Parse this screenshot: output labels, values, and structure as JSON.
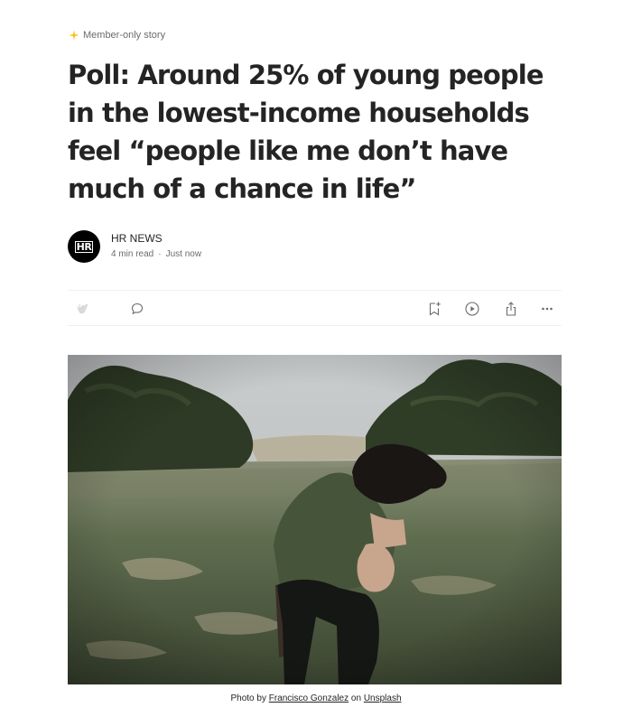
{
  "badge": {
    "label": "Member-only story",
    "icon": "star-icon",
    "color": "#ffc017"
  },
  "article": {
    "title": "Poll: Around 25% of young people in the lowest-income households feel “people like me don’t have much of a chance in life”"
  },
  "author": {
    "avatar_text": "HR",
    "name": "HR NEWS",
    "read_time": "4 min read",
    "separator": "·",
    "published": "Just now"
  },
  "actions": {
    "left": [
      "clap-icon",
      "comment-icon"
    ],
    "right": [
      "bookmark-add-icon",
      "listen-play-icon",
      "share-icon",
      "more-icon"
    ]
  },
  "hero": {
    "alt": "Man sitting in a field with his face in his hands"
  },
  "caption": {
    "prefix": "Photo by",
    "author_link": "Francisco Gonzalez",
    "middle": "on",
    "source_link": "Unsplash"
  }
}
